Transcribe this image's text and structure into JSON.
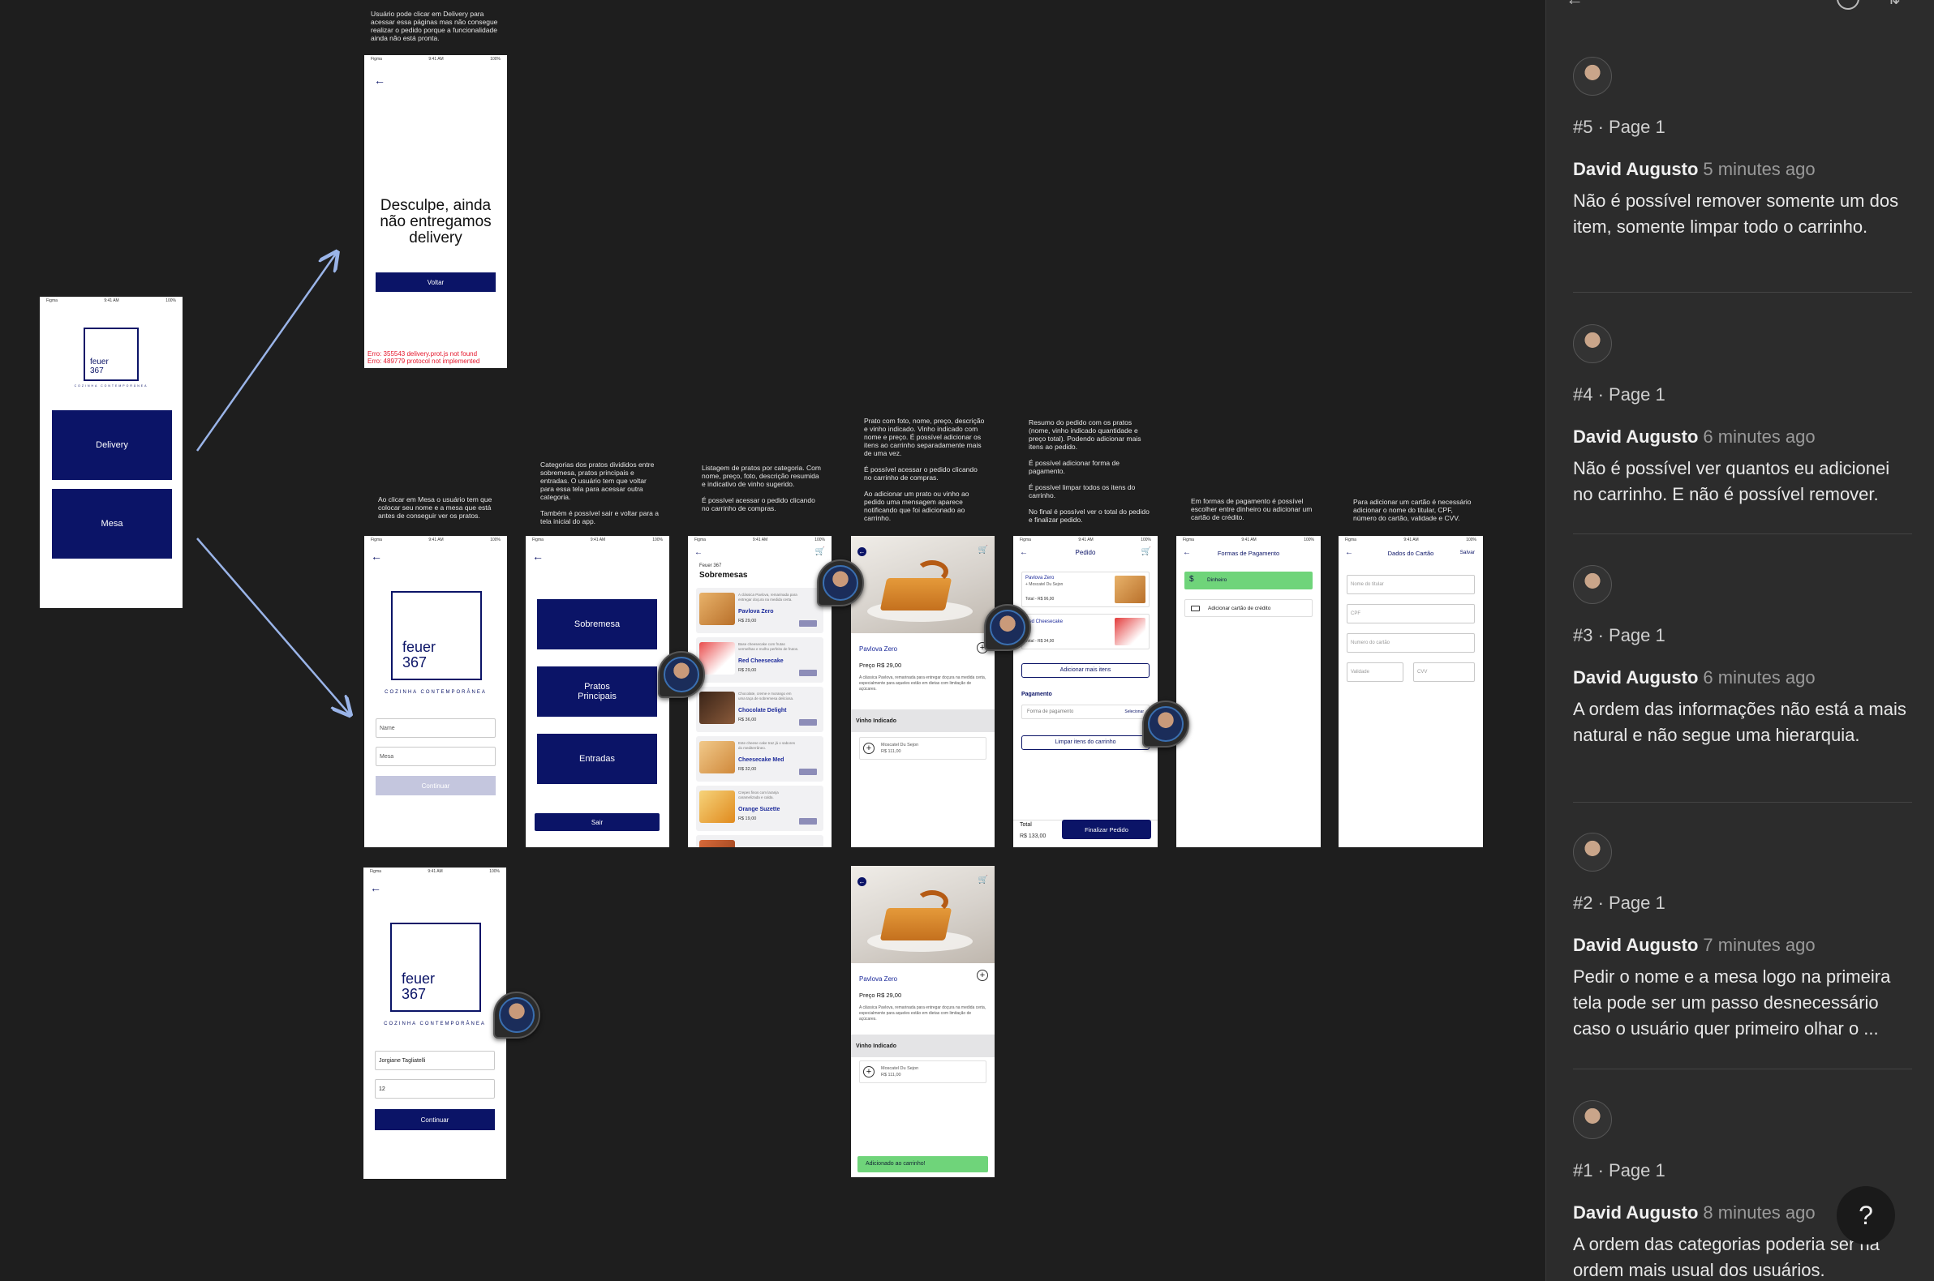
{
  "notes": {
    "delivery": "Usuário pode clicar em Delivery para acessar essa páginas mas não consegue realizar o pedido porque a funcionalidade ainda não está pronta.",
    "mesa": "Ao clicar em Mesa o usuário tem que colocar seu nome e a mesa que está antes de conseguir ver os pratos.",
    "categorias": "Categorias dos pratos divididos entre sobremesa, pratos principais e entradas. O usuário tem que voltar para essa tela para acessar outra categoria.\n\nTambém é possível sair e voltar para a tela inicial do app.",
    "listagem": "Listagem de pratos por categoria. Com nome, preço, foto, descrição resumida e indicativo de vinho sugerido.\n\nÉ possível acessar o pedido clicando no carrinho de compras.",
    "prato": "Prato com foto, nome, preço, descrição e vinho indicado. Vinho indicado com nome e preço. É possível adicionar os itens ao carrinho separadamente mais de uma vez.\n\nÉ possível acessar o pedido clicando no carrinho de compras.\n\nAo adicionar um prato ou vinho ao pedido uma mensagem aparece notificando que foi adicionado ao carrinho.",
    "resumo": "Resumo do pedido com os pratos (nome, vinho indicado quantidade e preço total). Podendo adicionar mais itens ao pedido.\n\nÉ possível adicionar forma de pagamento.\n\nÉ possível limpar todos os itens do carrinho.\n\nNo final é possível ver o total do pedido e finalizar pedido.",
    "pagamento": "Em formas de pagamento é possível escolher entre dinheiro ou adicionar um cartão de crédito.",
    "cartao": "Para adicionar um cartão é necessário adicionar o nome do titular, CPF, número do cartão, validade e CVV."
  },
  "status": {
    "carrier": "Figma",
    "time": "9:41 AM",
    "battery": "100%"
  },
  "splash": {
    "logo1": "feuer",
    "logo2": "367",
    "sub": "COZINHA CONTEMPORÂNEA",
    "delivery": "Delivery",
    "mesa": "Mesa"
  },
  "delivery": {
    "message": "Desculpe, ainda não entregamos delivery",
    "back": "Voltar",
    "error1": "Erro: 355543 delivery.prot.js not found",
    "error2": "Erro: 489779 protocol not implemented"
  },
  "login": {
    "logo1": "feuer",
    "logo2": "367",
    "sub": "COZINHA CONTEMPORÂNEA",
    "name_ph": "Name",
    "table_ph": "Mesa",
    "continue": "Continuar"
  },
  "login_filled": {
    "name": "Jorgiane Tagliatelli",
    "table": "12",
    "continue": "Continuar"
  },
  "categories": {
    "items": [
      "Sobremesa",
      "Pratos Principais",
      "Entradas"
    ],
    "exit": "Sair"
  },
  "list": {
    "brand": "Feuer 367",
    "title": "Sobremesas",
    "items": [
      {
        "name": "Pavlova Zero",
        "price": "R$ 29,00",
        "desc": "A clássica Pavlova, remarinada para entregar doçura na medida certa."
      },
      {
        "name": "Red Cheesecake",
        "price": "R$ 29,00",
        "desc": "Base cheesecake com frutas vermelhas e molho perfeito de frutos."
      },
      {
        "name": "Chocolate Delight",
        "price": "R$ 36,00",
        "desc": "Chocolate, creme e morango em uma taça de sobremesa deliciosa."
      },
      {
        "name": "Cheesecake Med",
        "price": "R$ 32,00",
        "desc": "Este cheese cake traz já o sabores do mediterrâneo."
      },
      {
        "name": "Orange Suzette",
        "price": "R$ 19,00",
        "desc": "Crepes finos com laranja caramelizada e calda."
      }
    ]
  },
  "dish": {
    "name": "Pavlova Zero",
    "price": "Preço R$ 29,00",
    "desc": "A clássica Pavlova, remarinada para entregar doçura na medida certa, especialmente para aqueles estão em dietas com limitação de açúcares.",
    "wine_header": "Vinho Indicado",
    "wine_name": "Moscatel Du Sejon",
    "wine_price": "R$ 111,00",
    "toast": "Adicionado ao carrinho!"
  },
  "order": {
    "title": "Pedido",
    "item1_name": "Pavlova Zero",
    "item1_sub": "+ Moscatel Du Sejon",
    "item1_total": "Total - R$ 96,00",
    "item2_name": "Red Cheesecake",
    "item2_total": "Total - R$ 34,00",
    "add_more": "Adicionar mais itens",
    "payment_header": "Pagamento",
    "payment_ph": "Forma de pagamento",
    "payment_select": "Selecionar",
    "clear": "Limpar itens do carrinho",
    "total_label": "Total",
    "total_value": "R$ 133,00",
    "finish": "Finalizar Pedido"
  },
  "payment": {
    "title": "Formas de Pagamento",
    "cash": "Dinheiro",
    "add_card": "Adicionar cartão de crédito"
  },
  "card": {
    "title": "Dados do Cartão",
    "save": "Salvar",
    "holder": "Nome do titular",
    "cpf": "CPF",
    "number": "Numero do cartão",
    "validity": "Validade",
    "cvv": "CVV"
  },
  "comments": [
    {
      "page": "#5 · Page 1",
      "author": "David Augusto",
      "time": "5 minutes ago",
      "body": "Não é possível remover somente um dos item, somente limpar todo o carrinho."
    },
    {
      "page": "#4 · Page 1",
      "author": "David Augusto",
      "time": "6 minutes ago",
      "body": "Não é possível ver quantos eu adicionei no carrinho. E não é possível remover."
    },
    {
      "page": "#3 · Page 1",
      "author": "David Augusto",
      "time": "6 minutes ago",
      "body": "A ordem das informações não está a mais natural e não segue uma hierarquia."
    },
    {
      "page": "#2 · Page 1",
      "author": "David Augusto",
      "time": "7 minutes ago",
      "body": "Pedir o nome e a mesa logo na primeira tela pode ser um passo desnecessário caso o usuário quer primeiro olhar o ..."
    },
    {
      "page": "#1 · Page 1",
      "author": "David Augusto",
      "time": "8 minutes ago",
      "body": "A ordem das categorias poderia ser na ordem mais usual dos usuários."
    }
  ],
  "help": "?",
  "colors": {
    "navy": "#0b1467",
    "canvas": "#1e1e1e",
    "panel": "#2c2c2c",
    "green": "#6fd47a",
    "error": "#e5162b"
  }
}
